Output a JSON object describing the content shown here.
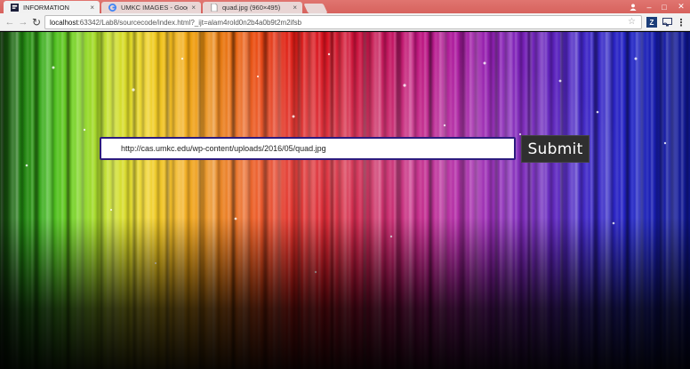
{
  "browser": {
    "tabs": [
      {
        "label": "INFORMATION",
        "icon": "page-favicon-icon",
        "active": true
      },
      {
        "label": "UMKC IMAGES - Google",
        "icon": "google-favicon-icon",
        "active": false
      },
      {
        "label": "quad.jpg (960×495)",
        "icon": "document-favicon-icon",
        "active": false
      }
    ],
    "close_glyph": "×",
    "address": {
      "host": "localhost",
      "rest": ":63342/Lab8/sourcecode/index.html?_ijt=alam4rold0n2b4a0b9t2m2ifsb"
    },
    "extensions": [
      "Z"
    ],
    "window_controls": {
      "minimize": "–",
      "maximize": "□",
      "close": "✕"
    }
  },
  "colors": {
    "tabbar": "#d7625d",
    "submit_bg": "#2f2f2f",
    "input_border": "#2c1b7e"
  },
  "form": {
    "url_value": "http://cas.umkc.edu/wp-content/uploads/2016/05/quad.jpg",
    "submit_label": "Submit"
  }
}
